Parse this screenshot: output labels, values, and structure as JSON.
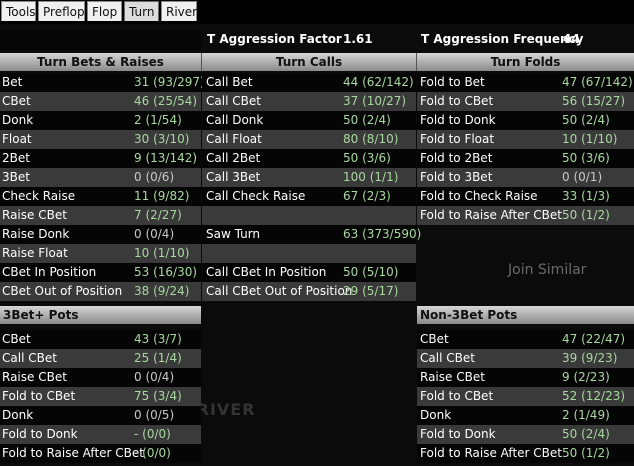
{
  "tabs": [
    "Tools",
    "Preflop",
    "Flop",
    "Turn",
    "River"
  ],
  "active_tab": "Turn",
  "summary": {
    "aggression_factor_label": "T Aggression Factor",
    "aggression_factor_value": "1.61",
    "aggression_frequency_label": "T Aggression Frequency",
    "aggression_frequency_value": "44"
  },
  "headers": {
    "bets_raises": "Turn Bets & Raises",
    "calls": "Turn Calls",
    "folds": "Turn Folds",
    "threebet_pots": "3Bet+ Pots",
    "non_threebet_pots": "Non-3Bet Pots"
  },
  "bets_raises": [
    {
      "label": "Bet",
      "value": "31 (93/297)"
    },
    {
      "label": "CBet",
      "value": "46 (25/54)"
    },
    {
      "label": "Donk",
      "value": "2 (1/54)"
    },
    {
      "label": "Float",
      "value": "30 (3/10)"
    },
    {
      "label": "2Bet",
      "value": "9 (13/142)"
    },
    {
      "label": "3Bet",
      "value": "0 (0/6)"
    },
    {
      "label": "Check Raise",
      "value": "11 (9/82)"
    },
    {
      "label": "Raise CBet",
      "value": "7 (2/27)"
    },
    {
      "label": "Raise Donk",
      "value": "0 (0/4)"
    },
    {
      "label": "Raise Float",
      "value": "10 (1/10)"
    },
    {
      "label": "CBet In Position",
      "value": "53 (16/30)"
    },
    {
      "label": "CBet Out of Position",
      "value": "38 (9/24)"
    }
  ],
  "calls": [
    {
      "label": "Call Bet",
      "value": "44 (62/142)"
    },
    {
      "label": "Call CBet",
      "value": "37 (10/27)"
    },
    {
      "label": "Call Donk",
      "value": "50 (2/4)"
    },
    {
      "label": "Call Float",
      "value": "80 (8/10)"
    },
    {
      "label": "Call 2Bet",
      "value": "50 (3/6)"
    },
    {
      "label": "Call 3Bet",
      "value": "100 (1/1)"
    },
    {
      "label": "Call Check Raise",
      "value": "67 (2/3)"
    },
    {
      "label": "",
      "value": ""
    },
    {
      "label": "Saw Turn",
      "value": "63 (373/590)"
    },
    {
      "label": "",
      "value": ""
    },
    {
      "label": "Call CBet In Position",
      "value": "50 (5/10)"
    },
    {
      "label": "Call CBet Out of Position",
      "value": "29 (5/17)"
    }
  ],
  "folds": [
    {
      "label": "Fold to Bet",
      "value": "47 (67/142)"
    },
    {
      "label": "Fold to CBet",
      "value": "56 (15/27)"
    },
    {
      "label": "Fold to Donk",
      "value": "50 (2/4)"
    },
    {
      "label": "Fold to Float",
      "value": "10 (1/10)"
    },
    {
      "label": "Fold to 2Bet",
      "value": "50 (3/6)"
    },
    {
      "label": "Fold to 3Bet",
      "value": "0 (0/1)"
    },
    {
      "label": "Fold to Check Raise",
      "value": "33 (1/3)"
    },
    {
      "label": "Fold to Raise After CBet",
      "value": "50 (1/2)"
    }
  ],
  "threebet_pots": [
    {
      "label": "CBet",
      "value": "43 (3/7)"
    },
    {
      "label": "Call CBet",
      "value": "25 (1/4)"
    },
    {
      "label": "Raise CBet",
      "value": "0 (0/4)"
    },
    {
      "label": "Fold to CBet",
      "value": "75 (3/4)"
    },
    {
      "label": "Donk",
      "value": "0 (0/5)"
    },
    {
      "label": "Fold to Donk",
      "value": "- (0/0)"
    },
    {
      "label": "Fold to Raise After CBet",
      "value": "- (0/0)"
    }
  ],
  "non_threebet_pots": [
    {
      "label": "CBet",
      "value": "47 (22/47)"
    },
    {
      "label": "Call CBet",
      "value": "39 (9/23)"
    },
    {
      "label": "Raise CBet",
      "value": "9 (2/23)"
    },
    {
      "label": "Fold to CBet",
      "value": "52 (12/23)"
    },
    {
      "label": "Donk",
      "value": "2 (1/49)"
    },
    {
      "label": "Fold to Donk",
      "value": "50 (2/4)"
    },
    {
      "label": "Fold to Raise After CBet",
      "value": "50 (1/2)"
    }
  ],
  "background_text": {
    "join_similar": "Join Similar",
    "flop_turn_river": "FLOP   TURN   RIVER"
  }
}
